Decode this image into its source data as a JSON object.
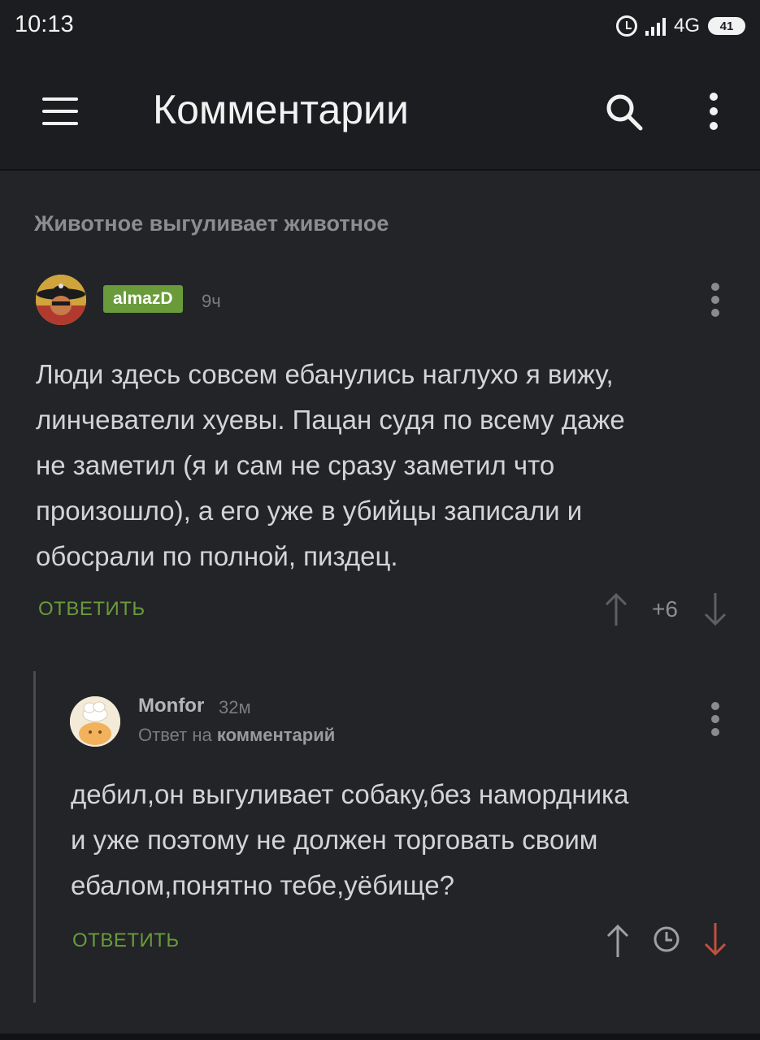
{
  "status": {
    "time": "10:13",
    "network": "4G",
    "battery": "41"
  },
  "appbar": {
    "title": "Комментарии"
  },
  "post": {
    "title": "Животное выгуливает животное"
  },
  "comment": {
    "username": "almazD",
    "time": "9ч",
    "text": "Люди здесь совсем ебанулись наглухо я вижу,\nлинчеватели хуевы. Пацан судя по всему даже\nне заметил (я и сам не сразу заметил что\nпроизошло), а его уже в убийцы записали и\nобосрали по полной, пиздец.",
    "reply_label": "ОТВЕТИТЬ",
    "score": "+6"
  },
  "reply": {
    "username": "Monfor",
    "time": "32м",
    "reply_to_prefix": "Ответ на",
    "reply_to_target": "комментарий",
    "text": "дебил,он выгуливает собаку,без намордника\nи уже поэтому не должен торговать своим\nебалом,понятно тебе,уёбище?",
    "reply_label": "ОТВЕТИТЬ"
  },
  "colors": {
    "accent": "#6a9b3b",
    "downvote_active": "#c0513f",
    "background": "#222428"
  },
  "icons": [
    "menu-icon",
    "search-icon",
    "more-vert-icon",
    "arrow-up-icon",
    "arrow-down-icon",
    "clock-icon",
    "alarm-icon",
    "signal-icon",
    "battery-icon"
  ]
}
